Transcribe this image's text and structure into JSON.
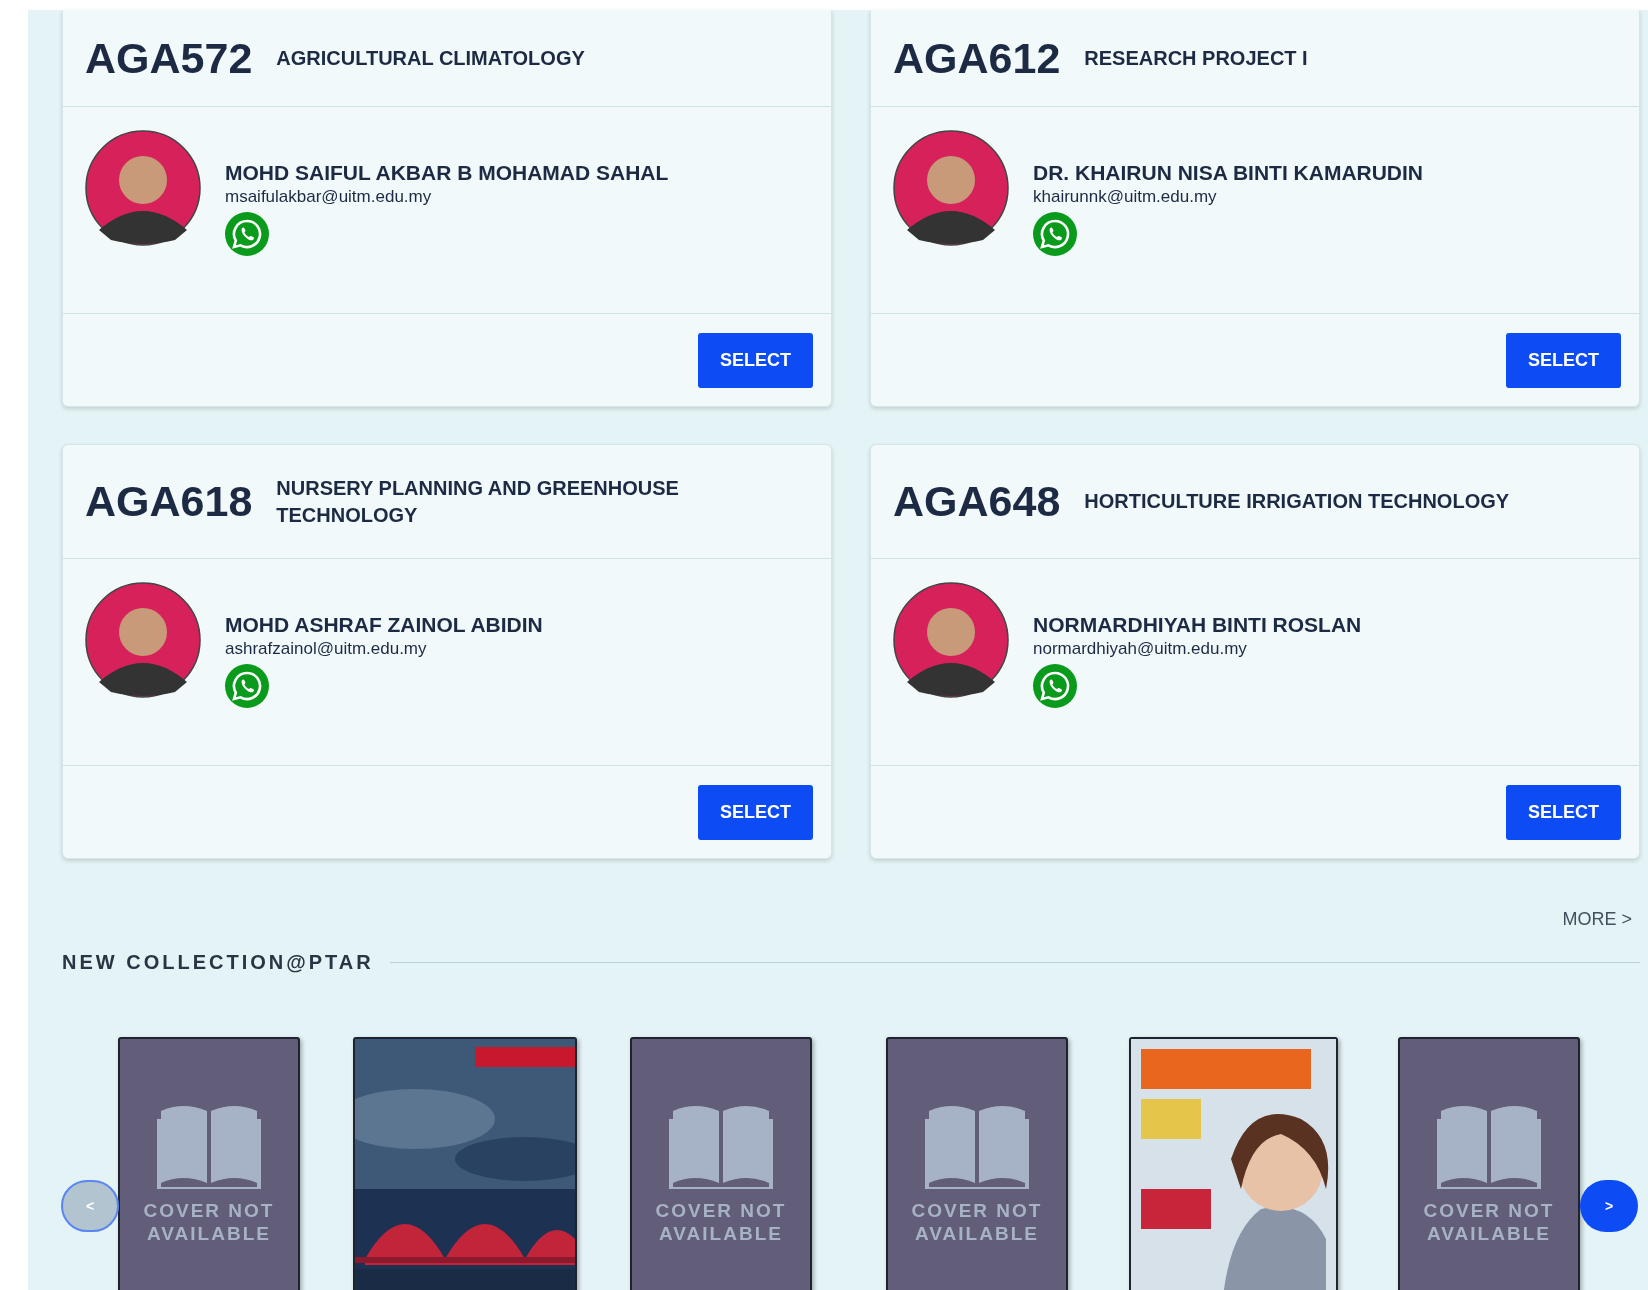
{
  "courses": [
    {
      "code": "AGA572",
      "title": "AGRICULTURAL CLIMATOLOGY",
      "lecturer": {
        "name": "MOHD SAIFUL AKBAR B MOHAMAD SAHAL",
        "email": "msaifulakbar@uitm.edu.my"
      },
      "action": "SELECT"
    },
    {
      "code": "AGA612",
      "title": "RESEARCH PROJECT I",
      "lecturer": {
        "name": "DR. KHAIRUN NISA BINTI KAMARUDIN",
        "email": "khairunnk@uitm.edu.my"
      },
      "action": "SELECT"
    },
    {
      "code": "AGA618",
      "title": "NURSERY PLANNING AND GREENHOUSE TECHNOLOGY",
      "lecturer": {
        "name": "MOHD ASHRAF ZAINOL ABIDIN",
        "email": "ashrafzainol@uitm.edu.my"
      },
      "action": "SELECT"
    },
    {
      "code": "AGA648",
      "title": "HORTICULTURE IRRIGATION TECHNOLOGY",
      "lecturer": {
        "name": "NORMARDHIYAH BINTI ROSLAN",
        "email": "normardhiyah@uitm.edu.my"
      },
      "action": "SELECT"
    }
  ],
  "collection": {
    "more": "MORE >",
    "heading": "NEW COLLECTION@PTAR",
    "prev": {
      "label": "<",
      "disabled": true
    },
    "next": {
      "label": ">",
      "disabled": false
    },
    "books": [
      {
        "kind": "placeholder",
        "caption": "COVER NOT AVAILABLE"
      },
      {
        "kind": "picture"
      },
      {
        "kind": "placeholder",
        "caption": "COVER NOT AVAILABLE"
      },
      {
        "kind": "placeholder",
        "caption": "COVER NOT AVAILABLE"
      },
      {
        "kind": "picture"
      },
      {
        "kind": "placeholder",
        "caption": "COVER NOT AVAILABLE"
      }
    ]
  }
}
